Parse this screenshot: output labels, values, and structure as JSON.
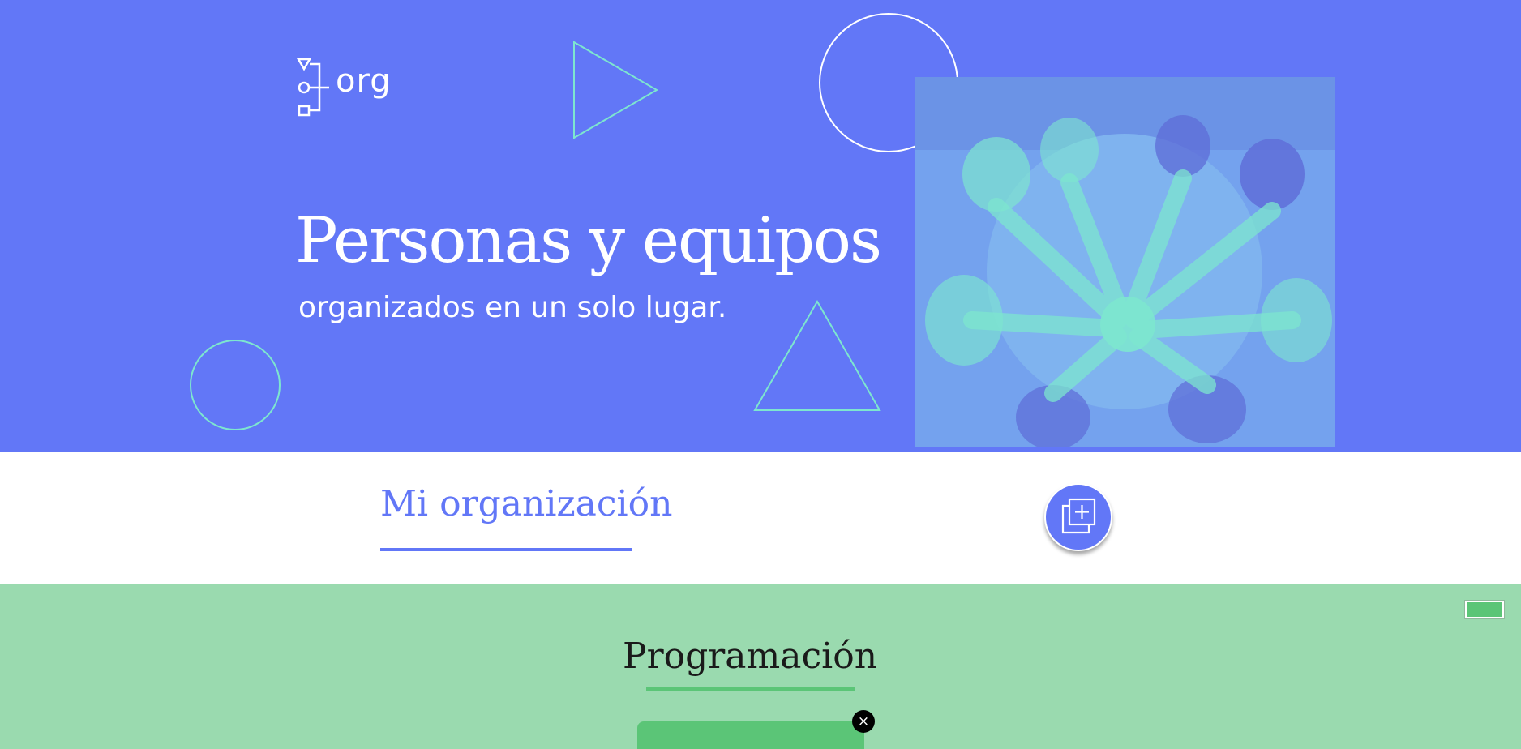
{
  "brand": {
    "logo_text": "org",
    "logo_icon": "org-chart-icon"
  },
  "hero": {
    "title": "Personas y equipos",
    "subtitle": "organizados en un solo lugar.",
    "photo_icon": "team-hands-photo",
    "decorations": [
      "triangle-right-outline",
      "circle-outline",
      "circle-outline",
      "triangle-up-outline"
    ]
  },
  "organization": {
    "title": "Mi organización",
    "add_button_icon": "add-to-collection-icon"
  },
  "programming": {
    "title": "Programación",
    "close_label": "×",
    "close_icon": "close-icon"
  },
  "colors": {
    "primary": "#6277F7",
    "accent_outline": "#7DE6CF",
    "green": "#5BC577",
    "green_light": "#9ADAAF",
    "photo_tint": "#74A2EE"
  }
}
